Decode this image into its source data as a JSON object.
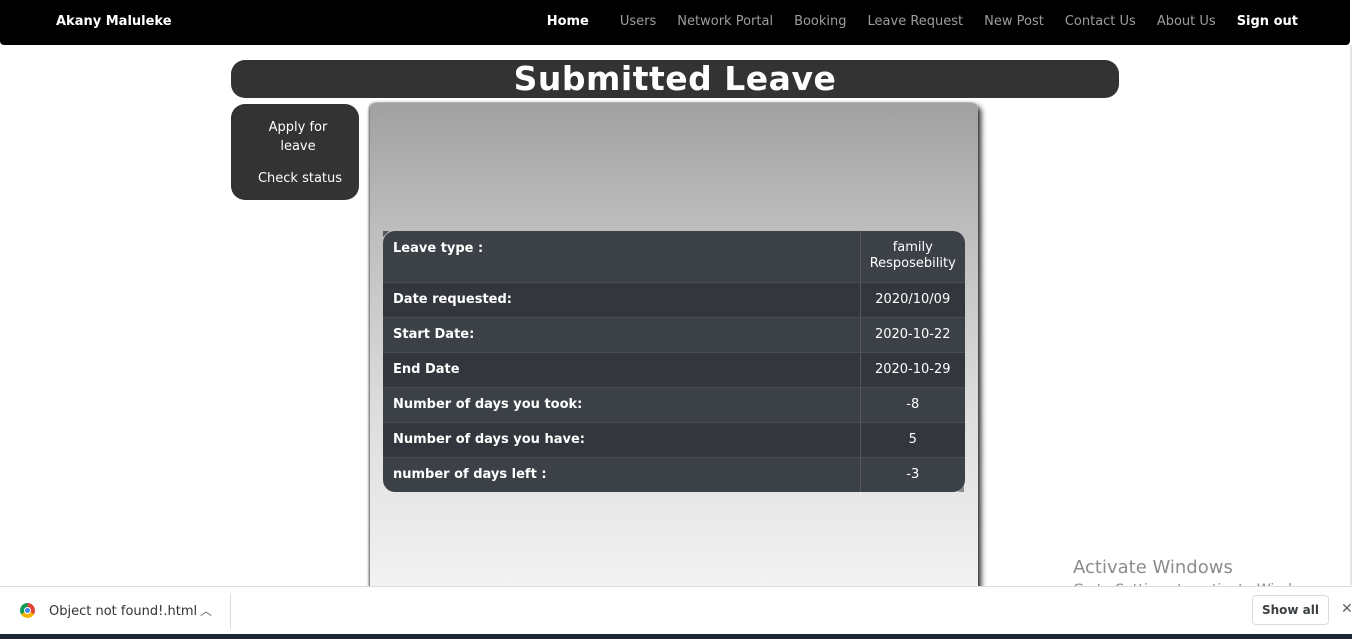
{
  "navbar": {
    "brand": "Akany Maluleke",
    "links": [
      "Home",
      "Users",
      "Network Portal",
      "Booking",
      "Leave Request",
      "New Post",
      "Contact Us",
      "About Us",
      "Sign out"
    ]
  },
  "page_title": "Submitted Leave",
  "side_menu": {
    "apply": "Apply for leave",
    "check": "Check status"
  },
  "leave_table": [
    {
      "label": "Leave type :",
      "value": "family Resposebility"
    },
    {
      "label": "Date requested:",
      "value": "2020/10/09"
    },
    {
      "label": "Start Date:",
      "value": "2020-10-22"
    },
    {
      "label": "End Date",
      "value": "2020-10-29"
    },
    {
      "label": "Number of days you took:",
      "value": "-8"
    },
    {
      "label": "Number of days you have:",
      "value": "5"
    },
    {
      "label": "number of days left :",
      "value": "-3"
    }
  ],
  "watermark": {
    "title": "Activate Windows",
    "subtitle": "Go to Settings to activate Windows."
  },
  "download_bar": {
    "filename": "Object not found!.html",
    "show_all": "Show all",
    "chevron_icon": "chevron-up-icon",
    "close_icon": "close-icon"
  }
}
